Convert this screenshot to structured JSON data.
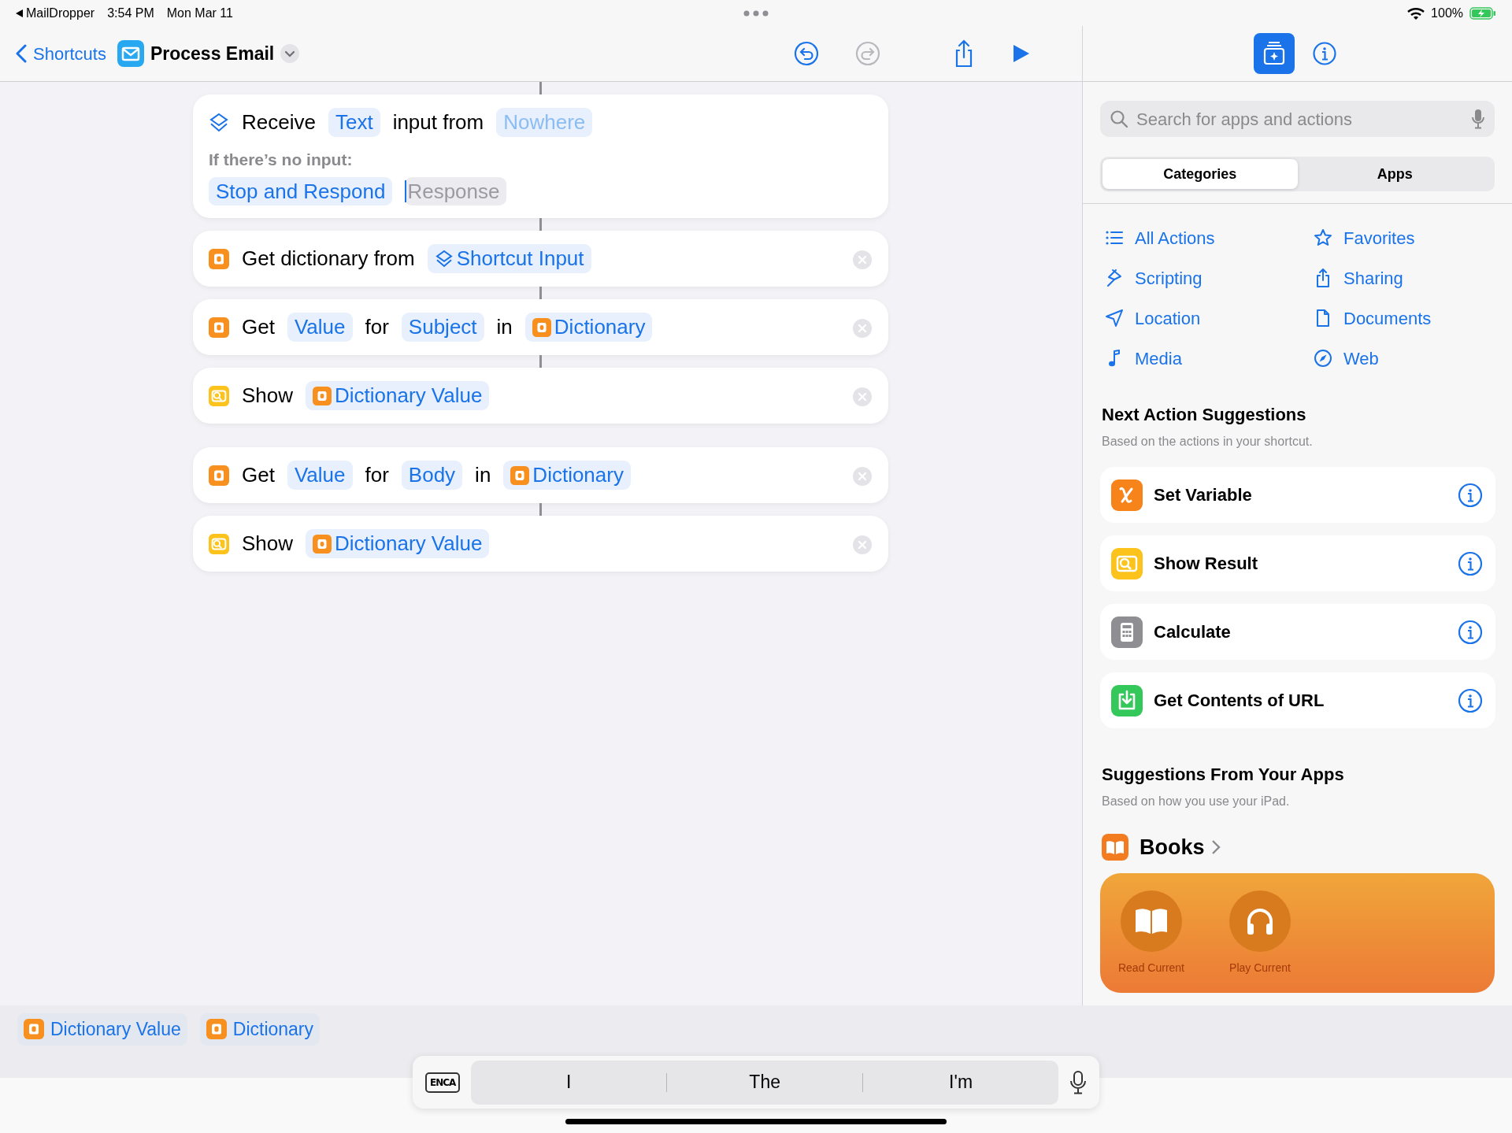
{
  "status_bar": {
    "back_app": "MailDropper",
    "time": "3:54 PM",
    "date": "Mon Mar 11",
    "battery": "100%"
  },
  "toolbar": {
    "back": "Shortcuts",
    "title": "Process Email",
    "buttons": [
      {
        "kind": "undo",
        "disabled": false
      },
      {
        "kind": "redo",
        "disabled": true
      },
      {
        "kind": "share",
        "disabled": false
      },
      {
        "kind": "play",
        "disabled": false
      }
    ]
  },
  "panel_toolbar": [
    {
      "kind": "library",
      "selected": true
    },
    {
      "kind": "info",
      "selected": false
    }
  ],
  "actions": [
    {
      "kind": "receive",
      "connected_above": true,
      "deletable": false,
      "lines": [
        [
          {
            "kind": "text",
            "text": "Receive"
          },
          {
            "kind": "param",
            "text": "Text"
          },
          {
            "kind": "text",
            "text": "input from"
          },
          {
            "kind": "unset",
            "text": "Nowhere"
          }
        ],
        [
          {
            "kind": "note",
            "text": "If there’s no input:"
          }
        ],
        [
          {
            "kind": "param",
            "text": "Stop and Respond"
          },
          {
            "kind": "field",
            "placeholder": "Response"
          }
        ]
      ]
    },
    {
      "kind": "dictionary",
      "connected_above": true,
      "deletable": true,
      "lines": [
        [
          {
            "kind": "text",
            "text": "Get dictionary from"
          },
          {
            "kind": "input_variable",
            "text": "Shortcut Input"
          }
        ]
      ]
    },
    {
      "kind": "dictionary",
      "connected_above": true,
      "deletable": true,
      "lines": [
        [
          {
            "kind": "text",
            "text": "Get"
          },
          {
            "kind": "param",
            "text": "Value"
          },
          {
            "kind": "text",
            "text": "for"
          },
          {
            "kind": "param",
            "text": "Subject"
          },
          {
            "kind": "text",
            "text": "in"
          },
          {
            "kind": "variable",
            "text": "Dictionary"
          }
        ]
      ]
    },
    {
      "kind": "show",
      "connected_above": true,
      "deletable": true,
      "lines": [
        [
          {
            "kind": "text",
            "text": "Show"
          },
          {
            "kind": "variable",
            "text": "Dictionary Value"
          }
        ]
      ]
    },
    {
      "kind": "dictionary",
      "connected_above": false,
      "deletable": true,
      "lines": [
        [
          {
            "kind": "text",
            "text": "Get"
          },
          {
            "kind": "param",
            "text": "Value"
          },
          {
            "kind": "text",
            "text": "for"
          },
          {
            "kind": "param",
            "text": "Body"
          },
          {
            "kind": "text",
            "text": "in"
          },
          {
            "kind": "variable",
            "text": "Dictionary"
          }
        ]
      ]
    },
    {
      "kind": "show",
      "connected_above": true,
      "deletable": true,
      "lines": [
        [
          {
            "kind": "text",
            "text": "Show"
          },
          {
            "kind": "variable",
            "text": "Dictionary Value"
          }
        ]
      ]
    }
  ],
  "panel": {
    "search": {
      "placeholder": "Search for apps and actions"
    },
    "segments": [
      {
        "label": "Categories",
        "selected": true
      },
      {
        "label": "Apps",
        "selected": false
      }
    ],
    "categories": [
      {
        "label": "All Actions",
        "kind": "list"
      },
      {
        "label": "Favorites",
        "kind": "star"
      },
      {
        "label": "Scripting",
        "kind": "scripting"
      },
      {
        "label": "Sharing",
        "kind": "share"
      },
      {
        "label": "Location",
        "kind": "location"
      },
      {
        "label": "Documents",
        "kind": "document"
      },
      {
        "label": "Media",
        "kind": "music"
      },
      {
        "label": "Web",
        "kind": "compass"
      }
    ],
    "next_actions": {
      "title": "Next Action Suggestions",
      "subtitle": "Based on the actions in your shortcut.",
      "items": [
        {
          "label": "Set Variable",
          "kind": "variable",
          "color": "#f7831b"
        },
        {
          "label": "Show Result",
          "kind": "show",
          "color": "#fbc31c"
        },
        {
          "label": "Calculate",
          "kind": "calculator",
          "color": "#8e8e93"
        },
        {
          "label": "Get Contents of URL",
          "kind": "download",
          "color": "#34c759"
        }
      ]
    },
    "app_suggestions": {
      "title": "Suggestions From Your Apps",
      "subtitle": "Based on how you use your iPad.",
      "app": "Books",
      "shortcuts": [
        {
          "label": "Read Current",
          "kind": "book"
        },
        {
          "label": "Play Current",
          "kind": "headphones"
        }
      ]
    }
  },
  "variables_bar": [
    {
      "label": "Dictionary Value"
    },
    {
      "label": "Dictionary"
    }
  ],
  "keyboard_bar": {
    "language": "ENCA",
    "predictions": [
      "I",
      "The",
      "I'm"
    ]
  }
}
